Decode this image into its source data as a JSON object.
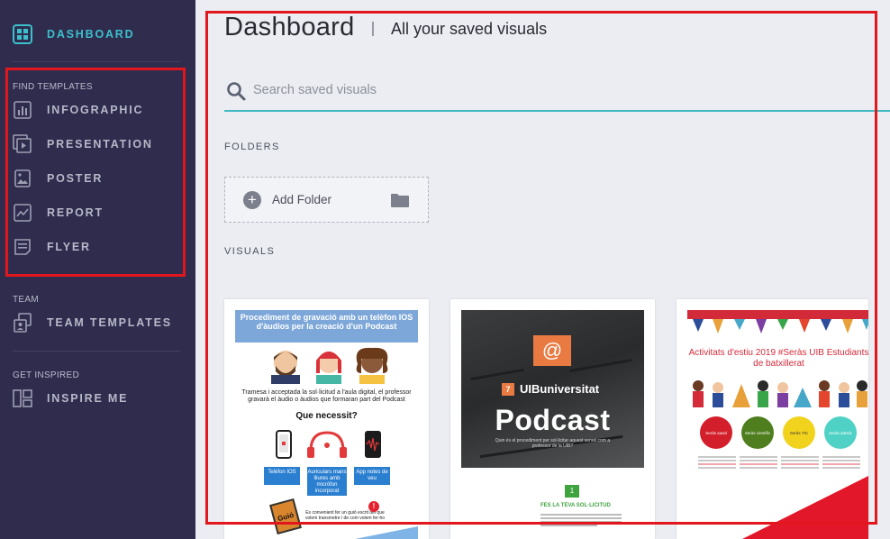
{
  "sidebar": {
    "dashboard": {
      "label": "DASHBOARD",
      "icon": "dashboard-icon"
    },
    "find_templates": {
      "heading": "FIND TEMPLATES",
      "items": [
        {
          "label": "INFOGRAPHIC",
          "icon": "bar-chart-icon"
        },
        {
          "label": "PRESENTATION",
          "icon": "presentation-icon"
        },
        {
          "label": "POSTER",
          "icon": "poster-image-icon"
        },
        {
          "label": "REPORT",
          "icon": "line-chart-icon"
        },
        {
          "label": "FLYER",
          "icon": "flyer-icon"
        }
      ]
    },
    "team": {
      "heading": "TEAM",
      "item": {
        "label": "TEAM TEMPLATES",
        "icon": "team-templates-icon"
      }
    },
    "inspired": {
      "heading": "GET INSPIRED",
      "item": {
        "label": "INSPIRE ME",
        "icon": "grid-layout-icon"
      }
    }
  },
  "main": {
    "title": "Dashboard",
    "subtitle": "All your saved visuals",
    "search": {
      "placeholder": "Search saved visuals"
    },
    "folders_label": "FOLDERS",
    "add_folder_label": "Add Folder",
    "visuals_label": "VISUALS"
  },
  "visuals": [
    {
      "heading": "Procediment de gravació amb un telèfon IOS d'àudios per la creació d'un Podcast",
      "intro": "Tramesa i acceptada la sol·licitud a l'aula digital, el professor gravarà el àudio o àudios que formaran part del Podcast",
      "need": "Que necessit?",
      "items": [
        "Telèfon IOS",
        "Auriculars mans lliures amb micròfon incorporat",
        "App notes de veu"
      ],
      "note": "Es convenient fer un guió escrit del que volem transmetre i de com volem fer-ho",
      "badge": "Guió"
    },
    {
      "brand": "UIBuniversitat",
      "title": "Podcast",
      "caption": "Quin és el procediment per sol·licitar aquest servei com a professor de la UIB?",
      "step_number": "1",
      "step_title": "FES LA TEVA SOL·LICITUD"
    },
    {
      "title": "Activitats d'estiu 2019 #Seràs UIB Estudiants de batxillerat",
      "circles": [
        "Seràs saval",
        "Seràs científic",
        "Seràs TIC",
        "Seràs artistic"
      ]
    }
  ],
  "colors": {
    "accent": "#3cc0cb",
    "sidebar": "#2f2c4e",
    "highlight": "#e2171e"
  }
}
